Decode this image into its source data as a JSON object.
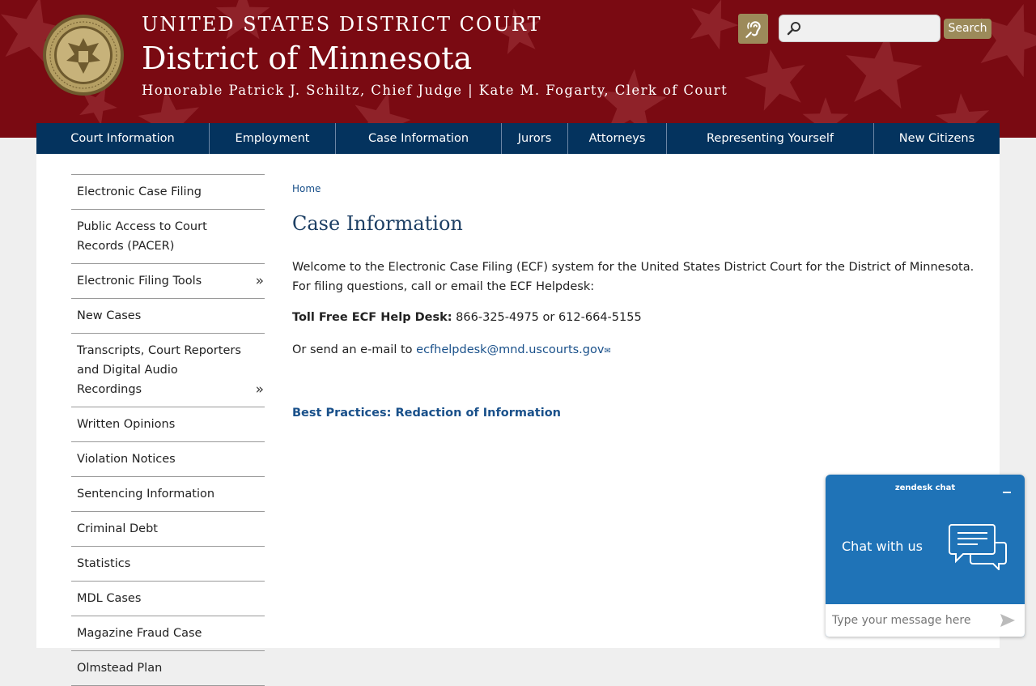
{
  "header": {
    "court_line": "UNITED STATES DISTRICT COURT",
    "district": "District of Minnesota",
    "judges": "Honorable Patrick J. Schiltz, Chief Judge | Kate M. Fogarty, Clerk of Court",
    "search_placeholder": "",
    "search_label": "Search"
  },
  "nav": {
    "items": [
      "Court Information",
      "Employment",
      "Case Information",
      "Jurors",
      "Attorneys",
      "Representing Yourself",
      "New Citizens"
    ]
  },
  "sidebar": {
    "items": [
      {
        "label": "Electronic Case Filing"
      },
      {
        "label": "Public Access to Court Records (PACER)"
      },
      {
        "label": "Electronic Filing Tools",
        "chevron": "»"
      },
      {
        "label": "New Cases"
      },
      {
        "label": "Transcripts, Court Reporters and Digital Audio Recordings",
        "chevron": "»"
      },
      {
        "label": "Written Opinions"
      },
      {
        "label": "Violation Notices"
      },
      {
        "label": "Sentencing Information"
      },
      {
        "label": "Criminal Debt"
      },
      {
        "label": "Statistics"
      },
      {
        "label": "MDL Cases"
      },
      {
        "label": "Magazine Fraud Case"
      },
      {
        "label": "Olmstead Plan"
      }
    ]
  },
  "main": {
    "breadcrumb": "Home",
    "title": "Case Information",
    "intro": "Welcome to the Electronic Case Filing (ECF) system for the United States District Court for the District of Minnesota.  For filing questions, call or email the ECF Helpdesk:",
    "tollfree_label": "Toll Free ECF Help Desk:",
    "tollfree_value": " 866-325-4975 or 612-664-5155",
    "email_prefix": "Or send an e-mail to ",
    "email_link": "ecfhelpdesk@mnd.uscourts.gov",
    "best_practices": "Best Practices: Redaction of Information"
  },
  "chat": {
    "brand": "zendesk chat",
    "headline": "Chat with us",
    "input_placeholder": "Type your message here"
  },
  "colors": {
    "header_bg": "#7a0a12",
    "nav_bg": "#04335e",
    "accent_gold": "#9c8a5a",
    "link_blue": "#19508a",
    "chat_blue": "#1f73b7"
  },
  "icons": {
    "accessibility": "assistive-listening-icon",
    "search": "search-icon",
    "seal": "court-seal",
    "chat_bubbles": "chat-bubbles-icon",
    "send": "send-icon",
    "minimize": "minimize-icon",
    "mail": "external-mail-icon"
  }
}
